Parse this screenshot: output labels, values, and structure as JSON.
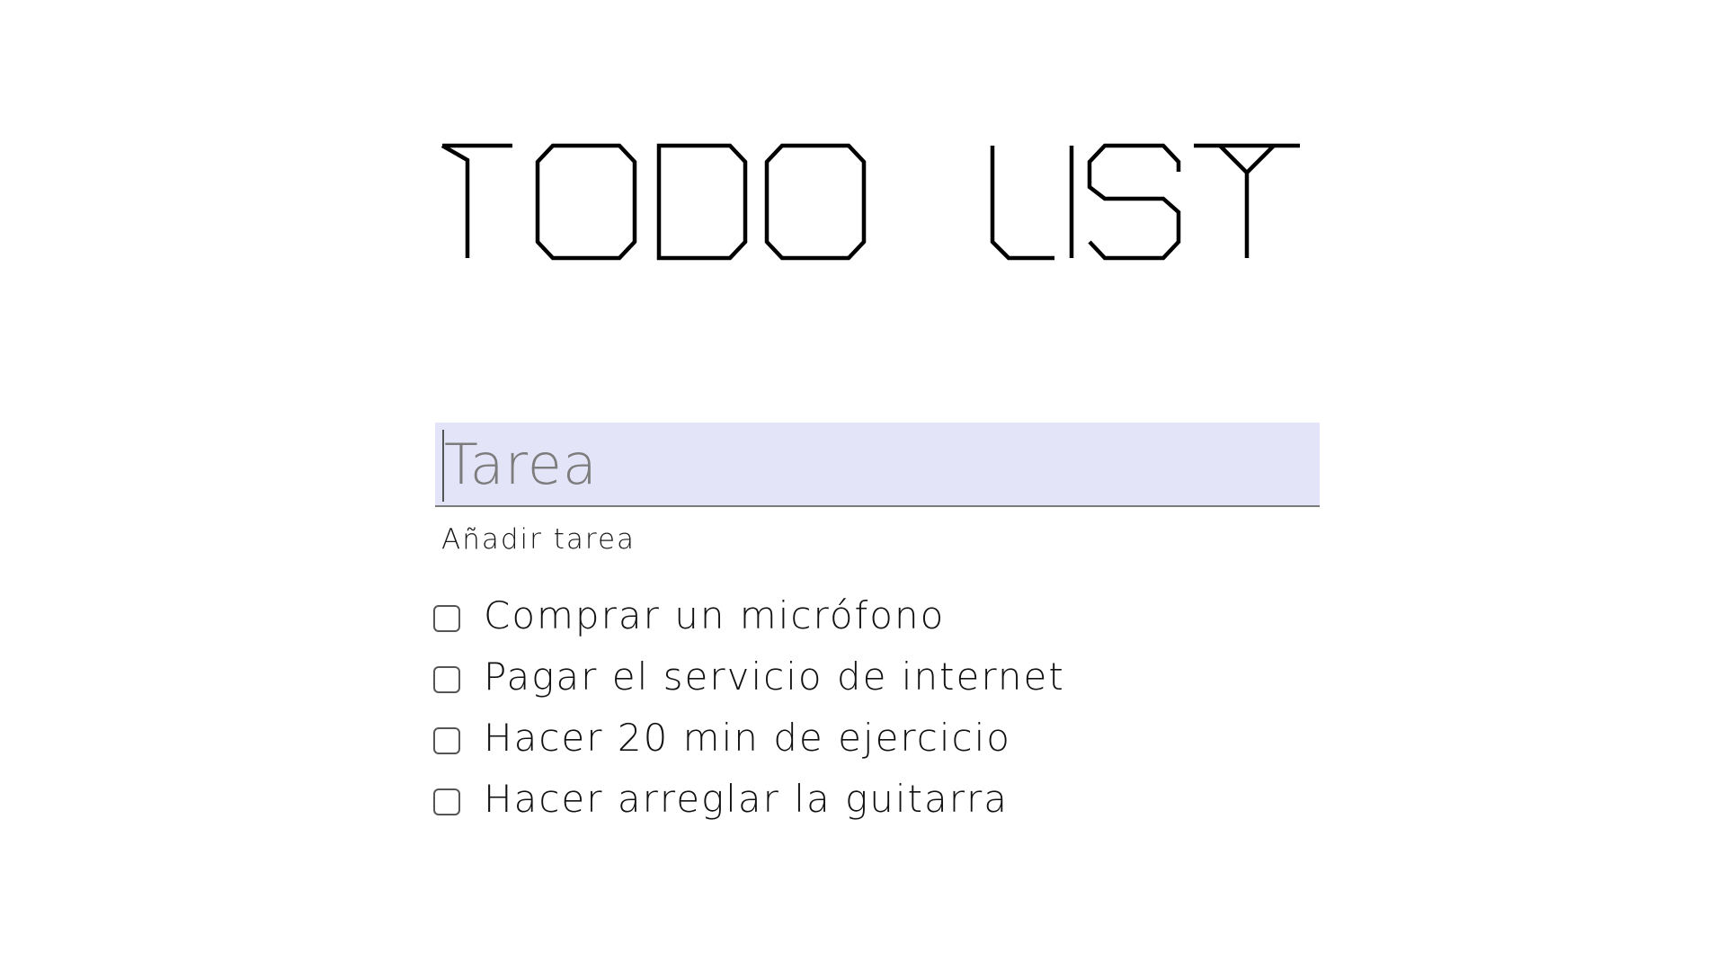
{
  "app": {
    "title": "TODO LIST"
  },
  "input": {
    "placeholder": "Tarea",
    "value": ""
  },
  "add_button": {
    "label": "Añadir tarea"
  },
  "tasks": [
    {
      "label": "Comprar un micrófono",
      "checked": false
    },
    {
      "label": "Pagar el servicio de internet",
      "checked": false
    },
    {
      "label": "Hacer 20 min de ejercicio",
      "checked": false
    },
    {
      "label": "Hacer arreglar la guitarra",
      "checked": false
    }
  ],
  "colors": {
    "input_background": "#e4e4f8",
    "input_underline": "#7a7a7a",
    "text": "#000000",
    "placeholder": "#7c7c7c",
    "checkbox_border": "#555555"
  }
}
